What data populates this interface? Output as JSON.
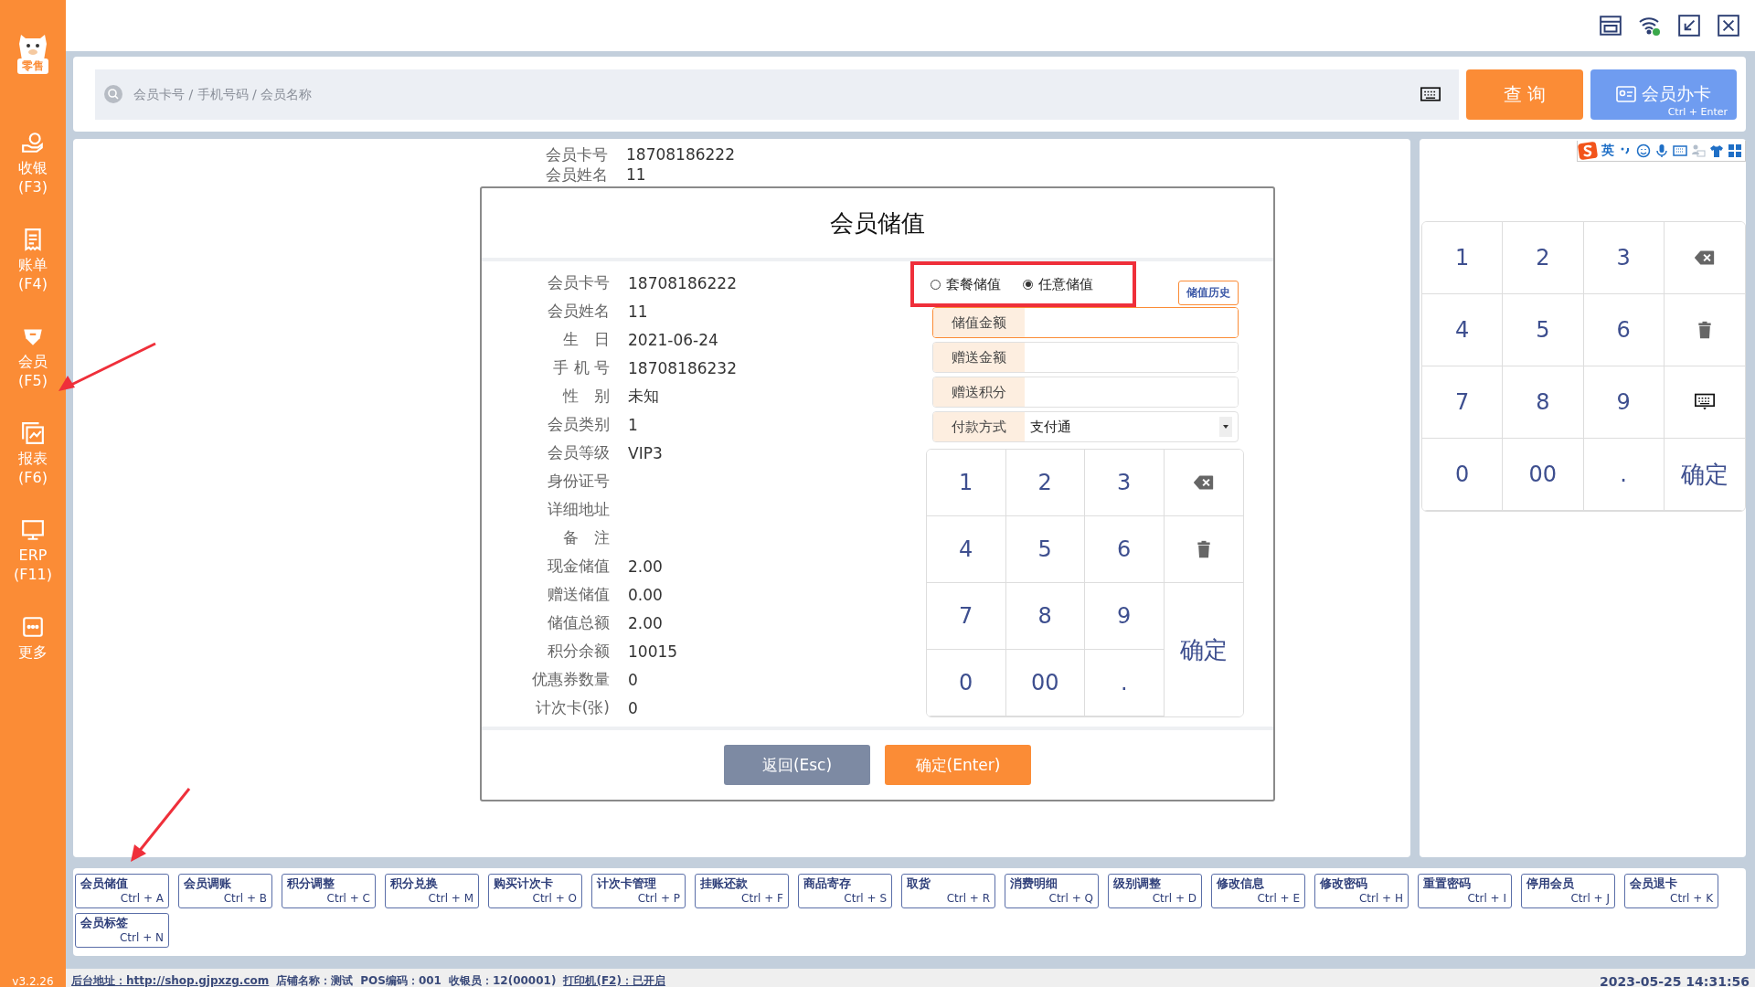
{
  "logo": {
    "badge": "零售"
  },
  "sidebar": {
    "items": [
      {
        "label": "收银",
        "key": "(F3)"
      },
      {
        "label": "账单",
        "key": "(F4)"
      },
      {
        "label": "会员",
        "key": "(F5)"
      },
      {
        "label": "报表",
        "key": "(F6)"
      },
      {
        "label": "ERP",
        "key": "(F11)"
      },
      {
        "label": "更多"
      }
    ],
    "version": "v3.2.26"
  },
  "search": {
    "placeholder": "会员卡号 / 手机号码 / 会员名称",
    "query_button": "查 询",
    "card_button": {
      "label": "会员办卡",
      "shortcut": "Ctrl + Enter"
    }
  },
  "background_info": [
    {
      "label": "会员卡号",
      "value": "18708186222"
    },
    {
      "label": "会员姓名",
      "value": "11"
    }
  ],
  "dialog": {
    "title": "会员储值",
    "info": [
      {
        "label": "会员卡号",
        "value": "18708186222"
      },
      {
        "label": "会员姓名",
        "value": "11"
      },
      {
        "label": "生　日",
        "value": "2021-06-24"
      },
      {
        "label": "手 机 号",
        "value": "18708186232"
      },
      {
        "label": "性　别",
        "value": "未知"
      },
      {
        "label": "会员类别",
        "value": "1"
      },
      {
        "label": "会员等级",
        "value": "VIP3"
      },
      {
        "label": "身份证号"
      },
      {
        "label": "详细地址"
      },
      {
        "label": "备　注"
      },
      {
        "label": "现金储值",
        "value": "2.00"
      },
      {
        "label": "赠送储值",
        "value": "0.00"
      },
      {
        "label": "储值总额",
        "value": "2.00"
      },
      {
        "label": "积分余额",
        "value": "10015"
      },
      {
        "label": "优惠券数量",
        "value": "0"
      },
      {
        "label": "计次卡(张)",
        "value": "0"
      }
    ],
    "modes": [
      {
        "label": "套餐储值",
        "selected": false
      },
      {
        "label": "任意储值",
        "selected": true
      }
    ],
    "history_button": "储值历史",
    "fields": [
      {
        "kind": "input",
        "label": "储值金额",
        "focused": true
      },
      {
        "kind": "input",
        "label": "赠送金额",
        "focused": false
      },
      {
        "kind": "input",
        "label": "赠送积分",
        "focused": false
      },
      {
        "kind": "select",
        "label": "付款方式",
        "value": "支付通",
        "focused": false
      }
    ],
    "keypad": [
      {
        "kind": "digit",
        "text": "1"
      },
      {
        "kind": "digit",
        "text": "2"
      },
      {
        "kind": "digit",
        "text": "3"
      },
      {
        "kind": "backspace"
      },
      {
        "kind": "digit",
        "text": "4"
      },
      {
        "kind": "digit",
        "text": "5"
      },
      {
        "kind": "digit",
        "text": "6"
      },
      {
        "kind": "clear"
      },
      {
        "kind": "digit",
        "text": "7"
      },
      {
        "kind": "digit",
        "text": "8"
      },
      {
        "kind": "digit",
        "text": "9"
      },
      {
        "kind": "confirm",
        "text": "确定",
        "tall": true
      },
      {
        "kind": "digit",
        "text": "0"
      },
      {
        "kind": "digit",
        "text": "00"
      },
      {
        "kind": "digit",
        "text": "."
      }
    ],
    "cancel_button": "返回(Esc)",
    "ok_button": "确定(Enter)"
  },
  "ime_toolbar": {
    "mode": "英"
  },
  "keypad": [
    {
      "kind": "digit",
      "text": "1"
    },
    {
      "kind": "digit",
      "text": "2"
    },
    {
      "kind": "digit",
      "text": "3"
    },
    {
      "kind": "backspace"
    },
    {
      "kind": "digit",
      "text": "4"
    },
    {
      "kind": "digit",
      "text": "5"
    },
    {
      "kind": "digit",
      "text": "6"
    },
    {
      "kind": "clear"
    },
    {
      "kind": "digit",
      "text": "7"
    },
    {
      "kind": "digit",
      "text": "8"
    },
    {
      "kind": "digit",
      "text": "9"
    },
    {
      "kind": "keyboard"
    },
    {
      "kind": "digit",
      "text": "0"
    },
    {
      "kind": "digit",
      "text": "00"
    },
    {
      "kind": "digit",
      "text": "."
    },
    {
      "kind": "confirm",
      "text": "确定",
      "tall": false
    }
  ],
  "shortcuts": [
    {
      "label": "会员储值",
      "keys": "Ctrl + A"
    },
    {
      "label": "会员调账",
      "keys": "Ctrl + B"
    },
    {
      "label": "积分调整",
      "keys": "Ctrl + C"
    },
    {
      "label": "积分兑换",
      "keys": "Ctrl + M"
    },
    {
      "label": "购买计次卡",
      "keys": "Ctrl + O"
    },
    {
      "label": "计次卡管理",
      "keys": "Ctrl + P"
    },
    {
      "label": "挂账还款",
      "keys": "Ctrl + F"
    },
    {
      "label": "商品寄存",
      "keys": "Ctrl + S"
    },
    {
      "label": "取货",
      "keys": "Ctrl + R"
    },
    {
      "label": "消费明细",
      "keys": "Ctrl + Q"
    },
    {
      "label": "级别调整",
      "keys": "Ctrl + D"
    },
    {
      "label": "修改信息",
      "keys": "Ctrl + E"
    },
    {
      "label": "修改密码",
      "keys": "Ctrl + H"
    },
    {
      "label": "重置密码",
      "keys": "Ctrl + I"
    },
    {
      "label": "停用会员",
      "keys": "Ctrl + J"
    },
    {
      "label": "会员退卡",
      "keys": "Ctrl + K"
    },
    {
      "label": "会员标签",
      "keys": "Ctrl + N"
    }
  ],
  "status_bar": {
    "items": [
      {
        "kind": "link",
        "text": "后台地址：http://shop.gjpxzg.com"
      },
      {
        "kind": "text",
        "text": "店铺名称：测试"
      },
      {
        "kind": "text",
        "text": "POS编码：001"
      },
      {
        "kind": "text",
        "text": "收银员：12(00001)"
      },
      {
        "kind": "link",
        "text": "打印机(F2)：已开启"
      }
    ],
    "datetime": "2023-05-25 14:31:56"
  }
}
